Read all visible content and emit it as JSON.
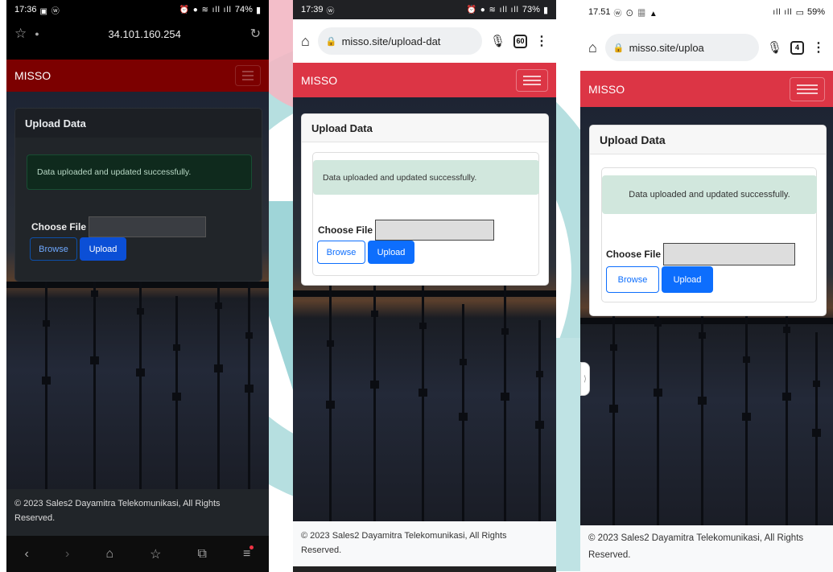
{
  "phones": [
    {
      "status": {
        "time": "17:36",
        "left_icons": "▣ ⓦ",
        "battery": "74%"
      },
      "browser": {
        "url": "34.101.160.254"
      },
      "app": {
        "brand": "MISSO"
      },
      "card": {
        "title": "Upload Data",
        "alert": "Data uploaded and updated successfully.",
        "choose_label": "Choose File",
        "browse_label": "Browse",
        "upload_label": "Upload"
      },
      "footer": "© 2023 Sales2 Dayamitra Telekomunikasi, All Rights Reserved."
    },
    {
      "status": {
        "time": "17:39",
        "left_icons": "ⓦ",
        "battery": "73%"
      },
      "browser": {
        "url": "misso.site/upload-dat",
        "tab_count": "60"
      },
      "app": {
        "brand": "MISSO"
      },
      "card": {
        "title": "Upload Data",
        "alert": "Data uploaded and updated successfully.",
        "choose_label": "Choose File",
        "browse_label": "Browse",
        "upload_label": "Upload"
      },
      "footer": "© 2023 Sales2 Dayamitra Telekomunikasi, All Rights Reserved."
    },
    {
      "status": {
        "time": "17.51",
        "left_icons": "ⓦ ⊙ ▦ ▲",
        "battery": "59%"
      },
      "browser": {
        "url": "misso.site/uploa",
        "tab_count": "4"
      },
      "app": {
        "brand": "MISSO"
      },
      "card": {
        "title": "Upload Data",
        "alert": "Data uploaded and updated successfully.",
        "choose_label": "Choose File",
        "browse_label": "Browse",
        "upload_label": "Upload"
      },
      "footer": "© 2023 Sales2 Dayamitra Telekomunikasi, All Rights Reserved."
    }
  ],
  "colors": {
    "navbar_dark": "#7c0000",
    "navbar_red": "#dc3545",
    "primary": "#0d6efd",
    "primary_dark": "#0b4fd6",
    "alert_green_bg": "#d1e7dd",
    "alert_dark_bg": "#0f2a1d"
  }
}
